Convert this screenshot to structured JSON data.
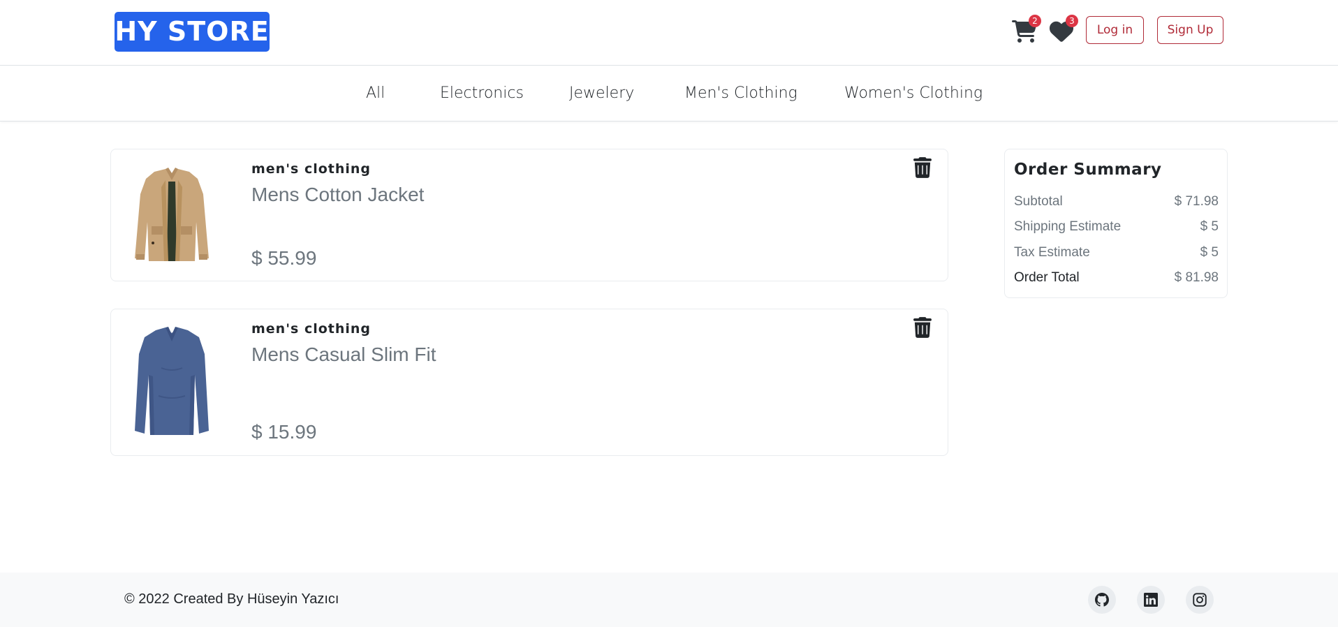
{
  "header": {
    "logo": "HY STORE",
    "cart_count": "2",
    "wishlist_count": "3",
    "login_label": "Log in",
    "signup_label": "Sign Up"
  },
  "categories": [
    "All",
    "Electronics",
    "Jewelery",
    "Men's Clothing",
    "Women's Clothing"
  ],
  "cart_items": [
    {
      "category": "men's clothing",
      "title": "Mens Cotton Jacket",
      "price": "$ 55.99",
      "image": "tan-jacket"
    },
    {
      "category": "men's clothing",
      "title": "Mens Casual Slim Fit",
      "price": "$ 15.99",
      "image": "blue-longsleeve-shirt"
    }
  ],
  "summary": {
    "title": "Order Summary",
    "rows": [
      {
        "label": "Subtotal",
        "value": "$ 71.98"
      },
      {
        "label": "Shipping Estimate",
        "value": "$ 5"
      },
      {
        "label": "Tax Estimate",
        "value": "$ 5"
      },
      {
        "label": "Order Total",
        "value": "$ 81.98"
      }
    ]
  },
  "footer": {
    "copyright": "© 2022 Created By Hüseyin Yazıcı",
    "social": [
      "github-icon",
      "linkedin-icon",
      "instagram-icon"
    ]
  },
  "colors": {
    "brand": "#2563eb",
    "danger": "#b02a37",
    "badge": "#dc3545"
  }
}
